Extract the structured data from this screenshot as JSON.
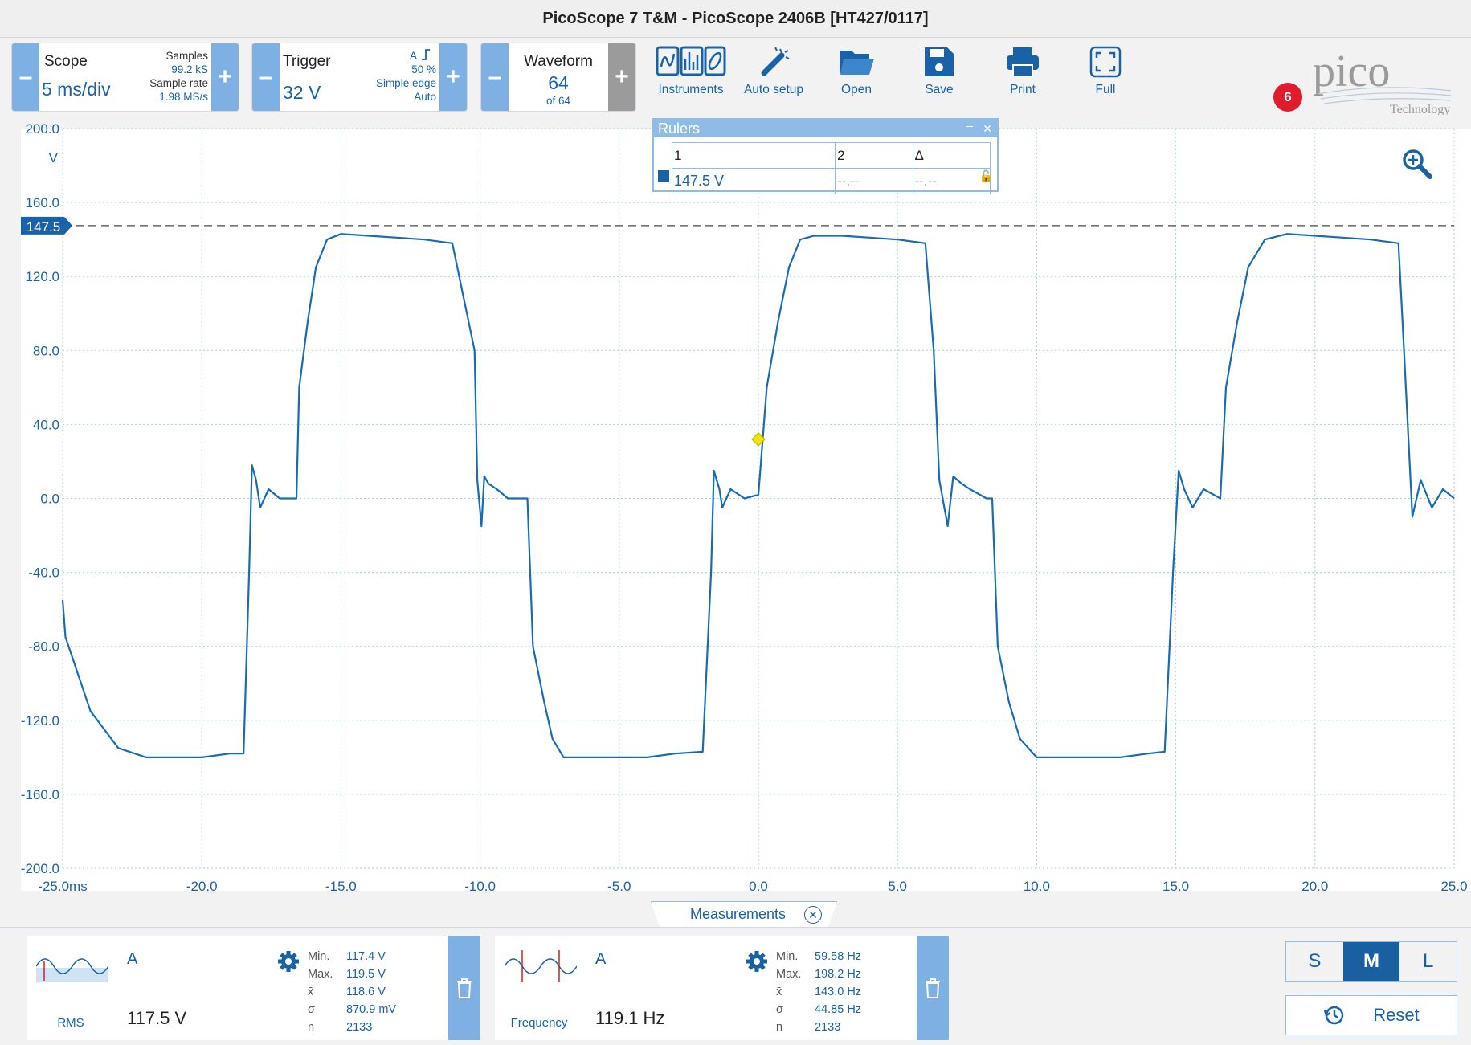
{
  "window": {
    "title": "PicoScope 7 T&M  - PicoScope 2406B [HT427/0117]"
  },
  "toolbar": {
    "scope": {
      "label": "Scope",
      "value": "5 ms/div",
      "samples_label": "Samples",
      "samples_value": "99.2 kS",
      "rate_label": "Sample rate",
      "rate_value": "1.98 MS/s"
    },
    "trigger": {
      "label": "Trigger",
      "value": "32 V",
      "channel": "A",
      "level": "50 %",
      "type": "Simple edge",
      "mode": "Auto"
    },
    "waveform": {
      "label": "Waveform",
      "value": "64",
      "of": "of 64"
    },
    "buttons": {
      "instruments": "Instruments",
      "auto_setup": "Auto setup",
      "open": "Open",
      "save": "Save",
      "print": "Print",
      "full": "Full"
    },
    "notification_count": "6",
    "logo_text": "pico",
    "logo_subtext": "Technology"
  },
  "rulers": {
    "title": "Rulers",
    "col1": "1",
    "col2": "2",
    "col3": "Δ",
    "val1": "147.5 V",
    "val2": "--.--",
    "val3": "--.--"
  },
  "chart_data": {
    "type": "line",
    "xlabel": "ms",
    "ylabel": "V",
    "xlim": [
      -25,
      25
    ],
    "ylim": [
      -200,
      200
    ],
    "grid": true,
    "x_ticks": [
      "-25.0",
      "-20.0",
      "-15.0",
      "-10.0",
      "-5.0",
      "0.0",
      "5.0",
      "10.0",
      "15.0",
      "20.0",
      "25.0"
    ],
    "y_ticks": [
      "200.0",
      "160.0",
      "120.0",
      "80.0",
      "40.0",
      "0.0",
      "-40.0",
      "-80.0",
      "-120.0",
      "-160.0",
      "-200.0"
    ],
    "ruler_value": 147.5,
    "ruler_label": "147.5",
    "trigger_marker": {
      "x": 0,
      "y": 32
    },
    "series_color": "#1a6bb5",
    "series": [
      {
        "x": [
          -25,
          -24.9,
          -24,
          -23,
          -22,
          -21,
          -20,
          -19,
          -18.5,
          -18.3,
          -18.2,
          -18.05,
          -17.9,
          -17.6,
          -17.2,
          -16.6,
          -16.5,
          -16.2,
          -15.9,
          -15.5,
          -15,
          -14,
          -13,
          -12,
          -11,
          -10.2,
          -10.1,
          -9.95,
          -9.85,
          -9.7,
          -9.4,
          -9.0,
          -8.3,
          -8.1,
          -7.7,
          -7.4,
          -7.0,
          -6.5,
          -6,
          -5,
          -4,
          -3,
          -2,
          -1.7,
          -1.6,
          -1.4,
          -1.3,
          -1.0,
          -0.5,
          0,
          0.3,
          0.7,
          1.1,
          1.5,
          2,
          3,
          4,
          5,
          6,
          6.3,
          6.5,
          6.8,
          7.0,
          7.3,
          7.6,
          8.2,
          8.4,
          8.6,
          9.0,
          9.4,
          10,
          11,
          12,
          13,
          14,
          14.6,
          14.9,
          15.1,
          15.3,
          15.6,
          16.0,
          16.6,
          16.8,
          17.2,
          17.6,
          18.2,
          19,
          20,
          21,
          22,
          23,
          23.2,
          23.5,
          23.8,
          24.2,
          24.6,
          25
        ],
        "y": [
          -55,
          -75,
          -115,
          -135,
          -140,
          -140,
          -140,
          -138,
          -138,
          -40,
          18,
          10,
          -5,
          5,
          0,
          0,
          60,
          95,
          125,
          140,
          143,
          142,
          141,
          140,
          138,
          80,
          10,
          -15,
          12,
          8,
          5,
          0,
          0,
          -80,
          -110,
          -130,
          -140,
          -140,
          -140,
          -140,
          -140,
          -138,
          -137,
          -40,
          15,
          5,
          -5,
          5,
          0,
          2,
          60,
          95,
          125,
          140,
          142,
          142,
          141,
          140,
          138,
          80,
          10,
          -15,
          12,
          8,
          5,
          0,
          0,
          -80,
          -110,
          -130,
          -140,
          -140,
          -140,
          -140,
          -138,
          -137,
          -40,
          15,
          5,
          -5,
          5,
          0,
          60,
          95,
          125,
          140,
          143,
          142,
          141,
          140,
          138,
          80,
          -10,
          10,
          -5,
          5,
          0
        ]
      }
    ]
  },
  "measurements": {
    "tab_label": "Measurements",
    "items": [
      {
        "name": "RMS",
        "channel": "A",
        "value": "117.5 V",
        "min_label": "Min.",
        "min": "117.4 V",
        "max_label": "Max.",
        "max": "119.5 V",
        "mean_label": "x̄",
        "mean": "118.6 V",
        "sd_label": "σ",
        "sd": "870.9 mV",
        "n_label": "n",
        "n": "2133"
      },
      {
        "name": "Frequency",
        "channel": "A",
        "value": "119.1 Hz",
        "min_label": "Min.",
        "min": "59.58 Hz",
        "max_label": "Max.",
        "max": "198.2 Hz",
        "mean_label": "x̄",
        "mean": "143.0 Hz",
        "sd_label": "σ",
        "sd": "44.85 Hz",
        "n_label": "n",
        "n": "2133"
      }
    ]
  },
  "size_selector": {
    "small": "S",
    "medium": "M",
    "large": "L",
    "active": "M"
  },
  "reset_label": "Reset",
  "colors": {
    "accent": "#1a62a8",
    "panel_blue": "#7fb0e3",
    "grid": "#9fd3d6",
    "badge": "#e01b2b"
  }
}
